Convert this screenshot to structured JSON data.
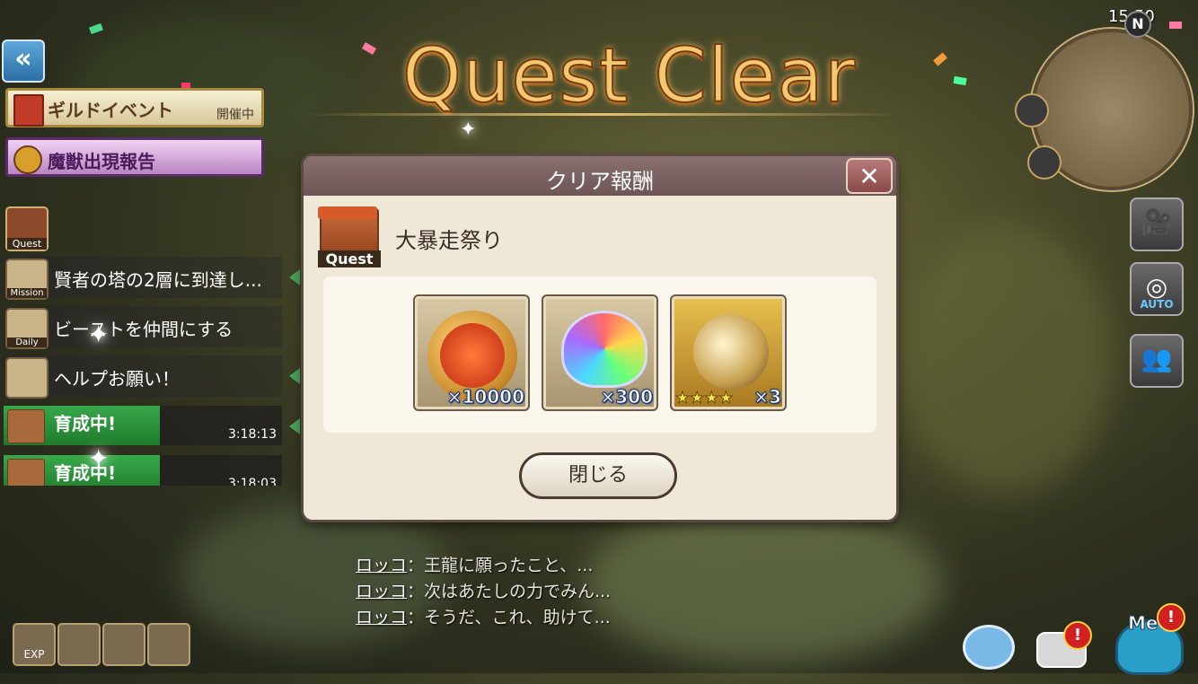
{
  "title": "Quest Clear",
  "clock": "15:50",
  "minimap_north": "N",
  "left_panel": {
    "guild_event": {
      "label": "ギルドイベント",
      "status": "開催中"
    },
    "beast_report": {
      "label": "魔獣出現報告"
    },
    "quest_icon_label": "Quest",
    "missions": [
      {
        "icon_label": "Mission",
        "text": "賢者の塔の2層に到達し..."
      },
      {
        "icon_label": "Daily",
        "text": "ビーストを仲間にする"
      },
      {
        "icon_label": "",
        "text": "ヘルプお願い！"
      }
    ],
    "training": [
      {
        "label": "育成中!",
        "time": "3:18:13"
      },
      {
        "label": "育成中!",
        "time": "3:18:03"
      }
    ],
    "bottom_icons": [
      {
        "label": "EXP"
      },
      {
        "label": ""
      },
      {
        "label": ""
      },
      {
        "label": ""
      }
    ]
  },
  "dialog": {
    "title": "クリア報酬",
    "close_symbol": "✕",
    "quest_icon_label": "Quest",
    "quest_name": "大暴走祭り",
    "rewards": [
      {
        "icon": "coin-icon",
        "count": "×10000"
      },
      {
        "icon": "crystal-icon",
        "count": "×300"
      },
      {
        "icon": "orb-icon",
        "stars": "★★★★",
        "count": "×3"
      }
    ],
    "close_button": "閉じる"
  },
  "chat": [
    {
      "speaker": "ロッコ",
      "text": "：王龍に願ったこと、..."
    },
    {
      "speaker": "ロッコ",
      "text": "：次はあたしの力でみん..."
    },
    {
      "speaker": "ロッコ",
      "text": "：そうだ、これ、助けて..."
    }
  ],
  "right_buttons": [
    {
      "name": "camera-icon",
      "label": ""
    },
    {
      "name": "auto-icon",
      "label": "AUTO"
    },
    {
      "name": "party-icon",
      "label": ""
    }
  ],
  "bottom_right": {
    "me_label": "Me",
    "alert": "!"
  }
}
